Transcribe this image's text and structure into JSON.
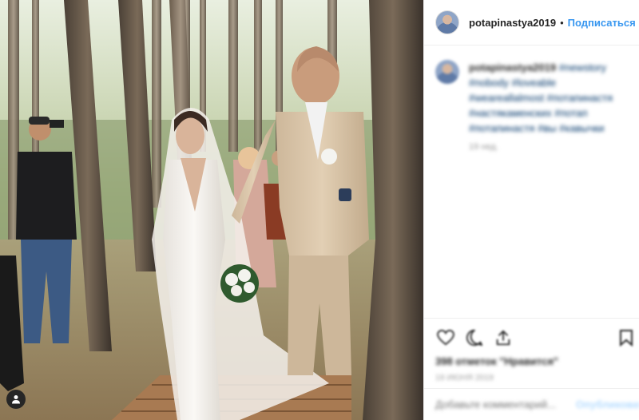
{
  "post": {
    "username": "potapinastya2019",
    "separator": "•",
    "follow_label": "Подписаться",
    "caption": {
      "username": "potapinastya2019",
      "hashtags": "#newstory #nobody #loveable #weareallalmost #потапинастя #настякаменских #потап #потапинастя #вы #кавычки",
      "time": "19 нед."
    },
    "likes": "398 отметок \"Нравится\"",
    "date": "19 ИЮНЯ 2019",
    "comment_placeholder": "Добавьте комментарий...",
    "publish_label": "Опубликовать"
  },
  "icons": {
    "like": "heart-icon",
    "comment": "comment-icon",
    "share": "share-icon",
    "save": "bookmark-icon",
    "user_tag": "person-tag-icon"
  },
  "colors": {
    "link": "#3897f0",
    "text": "#262626",
    "muted": "#999999",
    "border": "#efefef"
  }
}
